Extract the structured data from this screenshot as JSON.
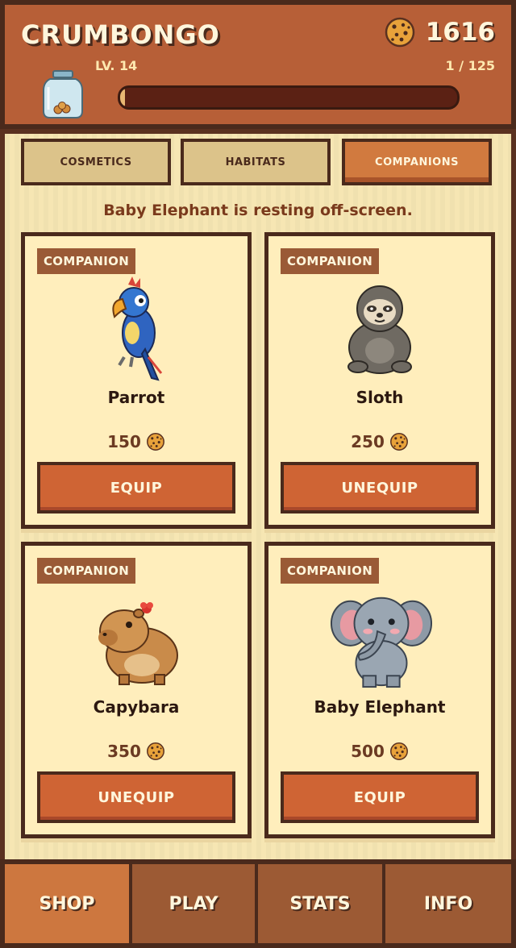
{
  "header": {
    "title": "CRUMBONGO",
    "coins": "1616",
    "level": "LV. 14",
    "progress_text": "1 / 125",
    "progress_fraction": 0.008
  },
  "tabs": [
    {
      "label": "COSMETICS",
      "active": false
    },
    {
      "label": "HABITATS",
      "active": false
    },
    {
      "label": "COMPANIONS",
      "active": true
    }
  ],
  "status_message": "Baby Elephant is resting off-screen.",
  "cards": [
    {
      "badge": "COMPANION",
      "name": "Parrot",
      "icon": "parrot-icon",
      "price": "150",
      "button": "EQUIP"
    },
    {
      "badge": "COMPANION",
      "name": "Sloth",
      "icon": "sloth-icon",
      "price": "250",
      "button": "UNEQUIP"
    },
    {
      "badge": "COMPANION",
      "name": "Capybara",
      "icon": "capybara-icon",
      "price": "350",
      "button": "UNEQUIP"
    },
    {
      "badge": "COMPANION",
      "name": "Baby Elephant",
      "icon": "elephant-icon",
      "price": "500",
      "button": "EQUIP"
    }
  ],
  "nav": [
    {
      "label": "SHOP",
      "active": true
    },
    {
      "label": "PLAY",
      "active": false
    },
    {
      "label": "STATS",
      "active": false
    },
    {
      "label": "INFO",
      "active": false
    }
  ],
  "colors": {
    "header_bg": "#b75f37",
    "content_bg": "#f6e6b3",
    "button": "#cf6434",
    "outline": "#4a2a1c",
    "active_tab": "#d17a3f"
  }
}
